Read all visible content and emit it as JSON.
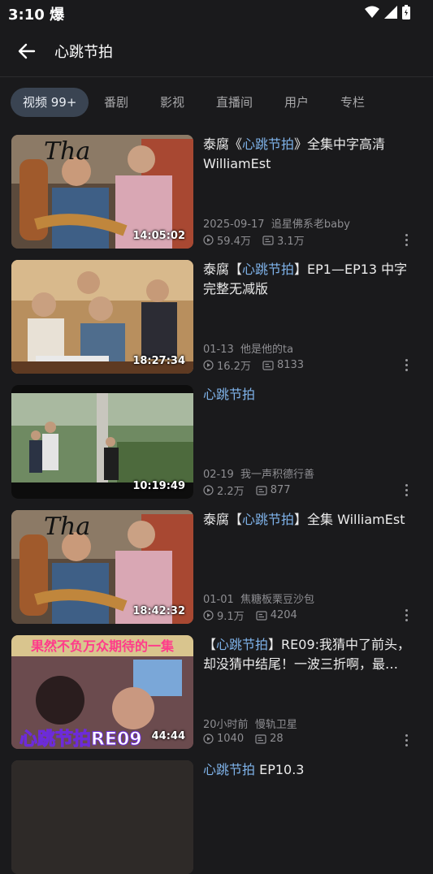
{
  "status_bar": {
    "time": "3:10",
    "extra_glyph": "爆"
  },
  "header": {
    "title": "心跳节拍"
  },
  "tabs": [
    {
      "label": "视频 99+"
    },
    {
      "label": "番剧"
    },
    {
      "label": "影视"
    },
    {
      "label": "直播间"
    },
    {
      "label": "用户"
    },
    {
      "label": "专栏"
    }
  ],
  "videos": [
    {
      "title_pre": "泰腐《",
      "title_hl": "心跳节拍",
      "title_post": "》全集中字高清 WilliamEst",
      "date": "2025-09-17",
      "uploader": "追星佛系老baby",
      "views": "59.4万",
      "danmaku": "3.1万",
      "duration": "14:05:02"
    },
    {
      "title_pre": "泰腐【",
      "title_hl": "心跳节拍",
      "title_post": "】EP1—EP13 中字完整无减版",
      "date": "01-13",
      "uploader": "他是他的ta",
      "views": "16.2万",
      "danmaku": "8133",
      "duration": "18:27:34"
    },
    {
      "title_pre": "",
      "title_hl": "心跳节拍",
      "title_post": "",
      "date": "02-19",
      "uploader": "我一声积德行善",
      "views": "2.2万",
      "danmaku": "877",
      "duration": "10:19:49"
    },
    {
      "title_pre": "泰腐【",
      "title_hl": "心跳节拍",
      "title_post": "】全集 WilliamEst",
      "date": "01-01",
      "uploader": "焦糖板栗豆沙包",
      "views": "9.1万",
      "danmaku": "4204",
      "duration": "18:42:32"
    },
    {
      "title_pre": "【",
      "title_hl": "心跳节拍",
      "title_post": "】RE09:我猜中了前头，却没猜中结尾！一波三折啊，最…",
      "date": "20小时前",
      "uploader": "慢轨卫星",
      "views": "1040",
      "danmaku": "28",
      "duration": "44:44",
      "thumb_caption_top": "果然不负万众期待的一集",
      "thumb_caption_bottom": "心跳节拍RE09"
    },
    {
      "title_pre": "",
      "title_hl": "心跳节拍",
      "title_post": " EP10.3",
      "date": "",
      "uploader": "",
      "views": "",
      "danmaku": "",
      "duration": ""
    }
  ],
  "colors": {
    "background": "#1a1a1c",
    "highlight": "#7fb3ea",
    "active_tab_bg": "#3a4452"
  },
  "icons": {
    "back": "arrow-left-icon",
    "views": "play-circle-icon",
    "danmaku": "danmaku-icon",
    "more": "more-vertical-icon",
    "wifi": "wifi-icon",
    "signal": "signal-icon",
    "battery": "battery-icon"
  }
}
